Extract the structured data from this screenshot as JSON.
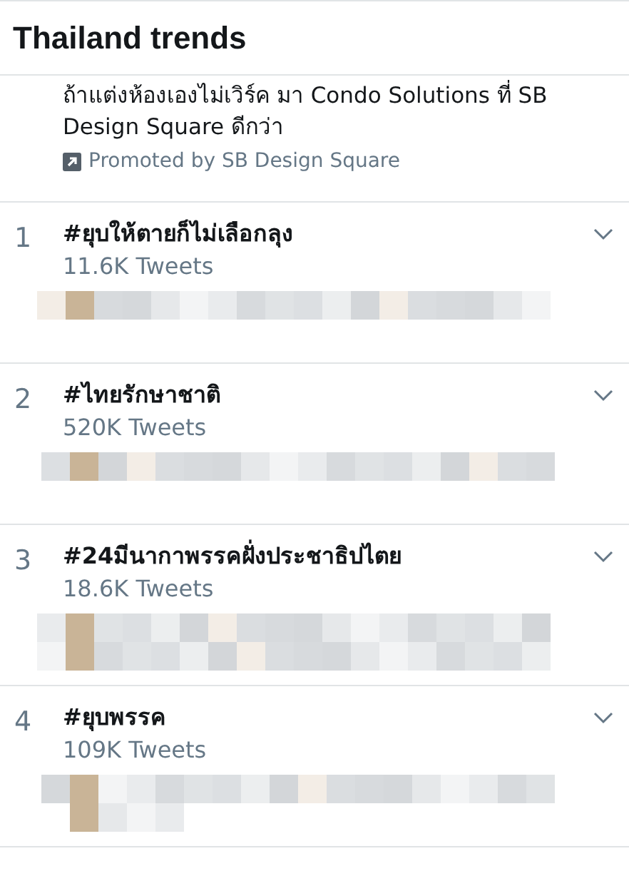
{
  "header": {
    "title": "Thailand trends"
  },
  "promoted": {
    "text": "ถ้าแต่งห้องเองไม่เวิร์ค มา Condo Solutions ที่ SB Design Square ดีกว่า",
    "label": "Promoted by SB Design Square"
  },
  "trends": [
    {
      "rank": "1",
      "hashtag": "#ยุบให้ตายก็ไม่เลือกลุง",
      "count": "11.6K Tweets"
    },
    {
      "rank": "2",
      "hashtag": "#ไทยรักษาชาติ",
      "count": "520K Tweets"
    },
    {
      "rank": "3",
      "hashtag": "#24มีนากาพรรคฝั่งประชาธิปไตย",
      "count": "18.6K Tweets"
    },
    {
      "rank": "4",
      "hashtag": "#ยุบพรรค",
      "count": "109K Tweets"
    }
  ]
}
